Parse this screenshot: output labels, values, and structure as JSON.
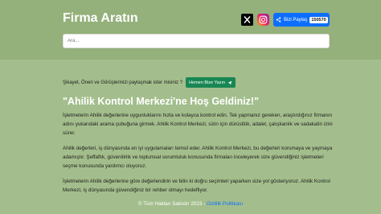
{
  "header": {
    "title": "Firma Aratın",
    "x_icon": "x-logo-icon",
    "instagram_icon": "instagram-icon",
    "share_label": "Bizi Paylaş",
    "share_count": "150570"
  },
  "search": {
    "placeholder": "Ara..."
  },
  "feedback": {
    "text": "Şikayet, Öneri ve Görüşlerinizi paylaşmak ister misiniz ?",
    "button_label": "Hemen Bize Yazın"
  },
  "welcome": {
    "title": "\"Ahilik Kontrol Merkezi'ne Hoş Geldiniz!\"",
    "paragraphs": [
      "İşletmelerin Ahilik değerlerine uygunluklarını hızla ve kolayca kontrol edin. Tek yapmanız gereken, araştırdığınız firmanın adını yukarıdaki arama çubuğuna girmek. Ahilik Kontrol Merkezi, sizin için dürüstlük, adalet, çalışkanlık ve sadakatin izini sürer.",
      "Ahilik değerleri, iş dünyasında en iyi uygulamaları temsil eder. Ahilik Kontrol Merkezi, bu değerleri korumaya ve yaymaya adamıştır. Şeffaflık, güvenilirlik ve toplumsal sorumluluk konusunda firmaları inceleyerek size güvendiğiniz işletmeleri seçme konusunda yardımcı oluyoruz.",
      "İşletmelerin Ahilik değerlerine göre değerlendirin ve bilin ki doğru seçimleri yaparken size yol gösteriyoruz. Ahilik Kontrol Merkezi, iş dünyasında güvendiğiniz bir rehber olmayı hedefliyor."
    ]
  },
  "footer": {
    "copyright": "© Tüm Hakları Saklıdır 2023 - ",
    "privacy_link": "Gizlilik Politikası"
  },
  "colors": {
    "background": "#a3be8c",
    "share_button": "#0d6efd",
    "feedback_button": "#198754"
  }
}
